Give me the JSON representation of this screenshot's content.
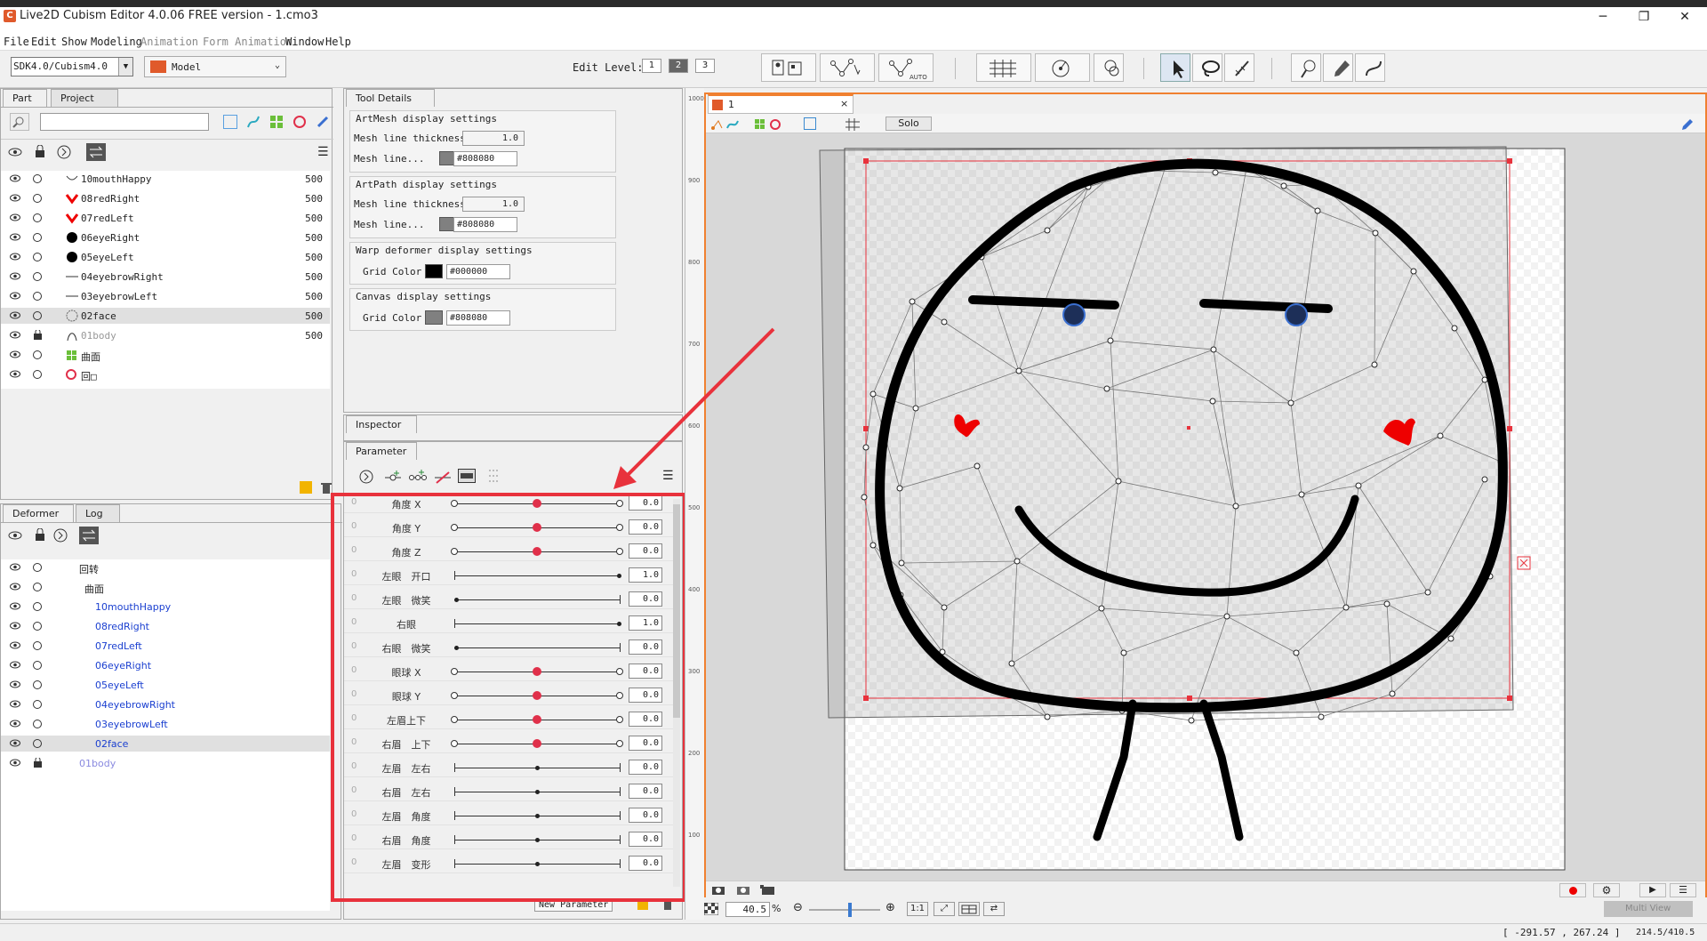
{
  "window": {
    "title": "Live2D Cubism Editor 4.0.06   FREE version  - 1.cmo3",
    "minimize": "─",
    "maximize": "❐",
    "close": "✕"
  },
  "menu": {
    "file": "File",
    "edit": "Edit",
    "show": "Show",
    "modeling": "Modeling",
    "animation": "Animation",
    "form_animation": "Form Animation",
    "window": "Window",
    "help": "Help"
  },
  "toolbar": {
    "sdk_value": "SDK4.0/Cubism4.0",
    "mode_value": "Model",
    "edit_level_label": "Edit Level:",
    "levels": [
      "1",
      "2",
      "3"
    ],
    "active_level": "2",
    "auto_label": "AUTO"
  },
  "part_panel": {
    "tabs": [
      "Part",
      "Project"
    ],
    "search_placeholder": "",
    "rows": [
      {
        "label": "10mouthHappy",
        "value": "500",
        "icon": "mouth-icon"
      },
      {
        "label": "08redRight",
        "value": "500",
        "icon": "red-blush-icon"
      },
      {
        "label": "07redLeft",
        "value": "500",
        "icon": "red-blush-icon"
      },
      {
        "label": "06eyeRight",
        "value": "500",
        "icon": "eye-dot-icon"
      },
      {
        "label": "05eyeLeft",
        "value": "500",
        "icon": "eye-dot-icon"
      },
      {
        "label": "04eyebrowRight",
        "value": "500",
        "icon": "brow-icon"
      },
      {
        "label": "03eyebrowLeft",
        "value": "500",
        "icon": "brow-icon"
      },
      {
        "label": "02face",
        "value": "500",
        "icon": "face-outline-icon"
      },
      {
        "label": "01body",
        "value": "500",
        "icon": "body-icon"
      },
      {
        "label": "曲面",
        "value": "",
        "icon": "warp-deformer-icon"
      },
      {
        "label": "回□",
        "value": "",
        "icon": "rotation-deformer-icon"
      }
    ]
  },
  "deformer_panel": {
    "tabs": [
      "Deformer",
      "Log"
    ],
    "rows": [
      {
        "label": "回转",
        "level": 0,
        "color": "#222222"
      },
      {
        "label": "曲面",
        "level": 1,
        "color": "#222222"
      },
      {
        "label": "10mouthHappy",
        "level": 2,
        "color": "#1a3fd0"
      },
      {
        "label": "08redRight",
        "level": 2,
        "color": "#1a3fd0"
      },
      {
        "label": "07redLeft",
        "level": 2,
        "color": "#1a3fd0"
      },
      {
        "label": "06eyeRight",
        "level": 2,
        "color": "#1a3fd0"
      },
      {
        "label": "05eyeLeft",
        "level": 2,
        "color": "#1a3fd0"
      },
      {
        "label": "04eyebrowRight",
        "level": 2,
        "color": "#1a3fd0"
      },
      {
        "label": "03eyebrowLeft",
        "level": 2,
        "color": "#1a3fd0"
      },
      {
        "label": "02face",
        "level": 2,
        "color": "#1a3fd0"
      },
      {
        "label": "01body",
        "level": 0,
        "color": "#8a8ae0"
      }
    ]
  },
  "tool_details": {
    "tab": "Tool Details",
    "artmesh": {
      "title": "ArtMesh display settings",
      "thickness_label": "Mesh line thickness",
      "thickness_value": "1.0",
      "color_label": "Mesh line...",
      "color_hex": "#808080"
    },
    "artpath": {
      "title": "ArtPath display settings",
      "thickness_label": "Mesh line thickness",
      "thickness_value": "1.0",
      "color_label": "Mesh line...",
      "color_hex": "#808080"
    },
    "warp": {
      "title": "Warp deformer display settings",
      "grid_label": "Grid Color",
      "grid_hex": "#000000"
    },
    "canvas": {
      "title": "Canvas display settings",
      "grid_label": "Grid Color",
      "grid_hex": "#808080"
    }
  },
  "inspector": {
    "tab": "Inspector"
  },
  "parameter_panel": {
    "tab": "Parameter",
    "new_parameter": "New Parameter",
    "params": [
      {
        "name": "角度 X",
        "value": "0.0",
        "style": "three",
        "pos": 0.5
      },
      {
        "name": "角度 Y",
        "value": "0.0",
        "style": "three",
        "pos": 0.5
      },
      {
        "name": "角度 Z",
        "value": "0.0",
        "style": "three",
        "pos": 0.5
      },
      {
        "name": "左眼　开口",
        "value": "1.0",
        "style": "end",
        "pos": 1.0
      },
      {
        "name": "左眼　微笑",
        "value": "0.0",
        "style": "start",
        "pos": 0.0
      },
      {
        "name": "右眼",
        "value": "1.0",
        "style": "end",
        "pos": 1.0
      },
      {
        "name": "右眼　微笑",
        "value": "0.0",
        "style": "start",
        "pos": 0.0
      },
      {
        "name": "眼球 X",
        "value": "0.0",
        "style": "three",
        "pos": 0.5
      },
      {
        "name": "眼球 Y",
        "value": "0.0",
        "style": "three",
        "pos": 0.5
      },
      {
        "name": "左眉上下",
        "value": "0.0",
        "style": "three",
        "pos": 0.5
      },
      {
        "name": "右眉　上下",
        "value": "0.0",
        "style": "three",
        "pos": 0.5
      },
      {
        "name": "左眉　左右",
        "value": "0.0",
        "style": "mid",
        "pos": 0.5
      },
      {
        "name": "右眉　左右",
        "value": "0.0",
        "style": "mid",
        "pos": 0.5
      },
      {
        "name": "左眉　角度",
        "value": "0.0",
        "style": "mid",
        "pos": 0.5
      },
      {
        "name": "右眉　角度",
        "value": "0.0",
        "style": "mid",
        "pos": 0.5
      },
      {
        "name": "左眉　变形",
        "value": "0.0",
        "style": "mid",
        "pos": 0.5
      }
    ]
  },
  "ruler": {
    "labels": [
      "1000",
      "900",
      "800",
      "700",
      "600",
      "500",
      "400",
      "300",
      "200",
      "100"
    ]
  },
  "view": {
    "tab_label": "1",
    "solo_label": "Solo",
    "zoom": "40.5",
    "zoom_unit": "%",
    "ratio_label": "1:1",
    "multi_view": "Multi View",
    "coords": "[ -291.57 ,   267.24 ]",
    "coords2": "214.5/410.5"
  },
  "colors": {
    "accent": "#f08030",
    "highlight_red": "#e8323c",
    "knob": "#e0304a",
    "link_blue": "#1a3fd0"
  }
}
